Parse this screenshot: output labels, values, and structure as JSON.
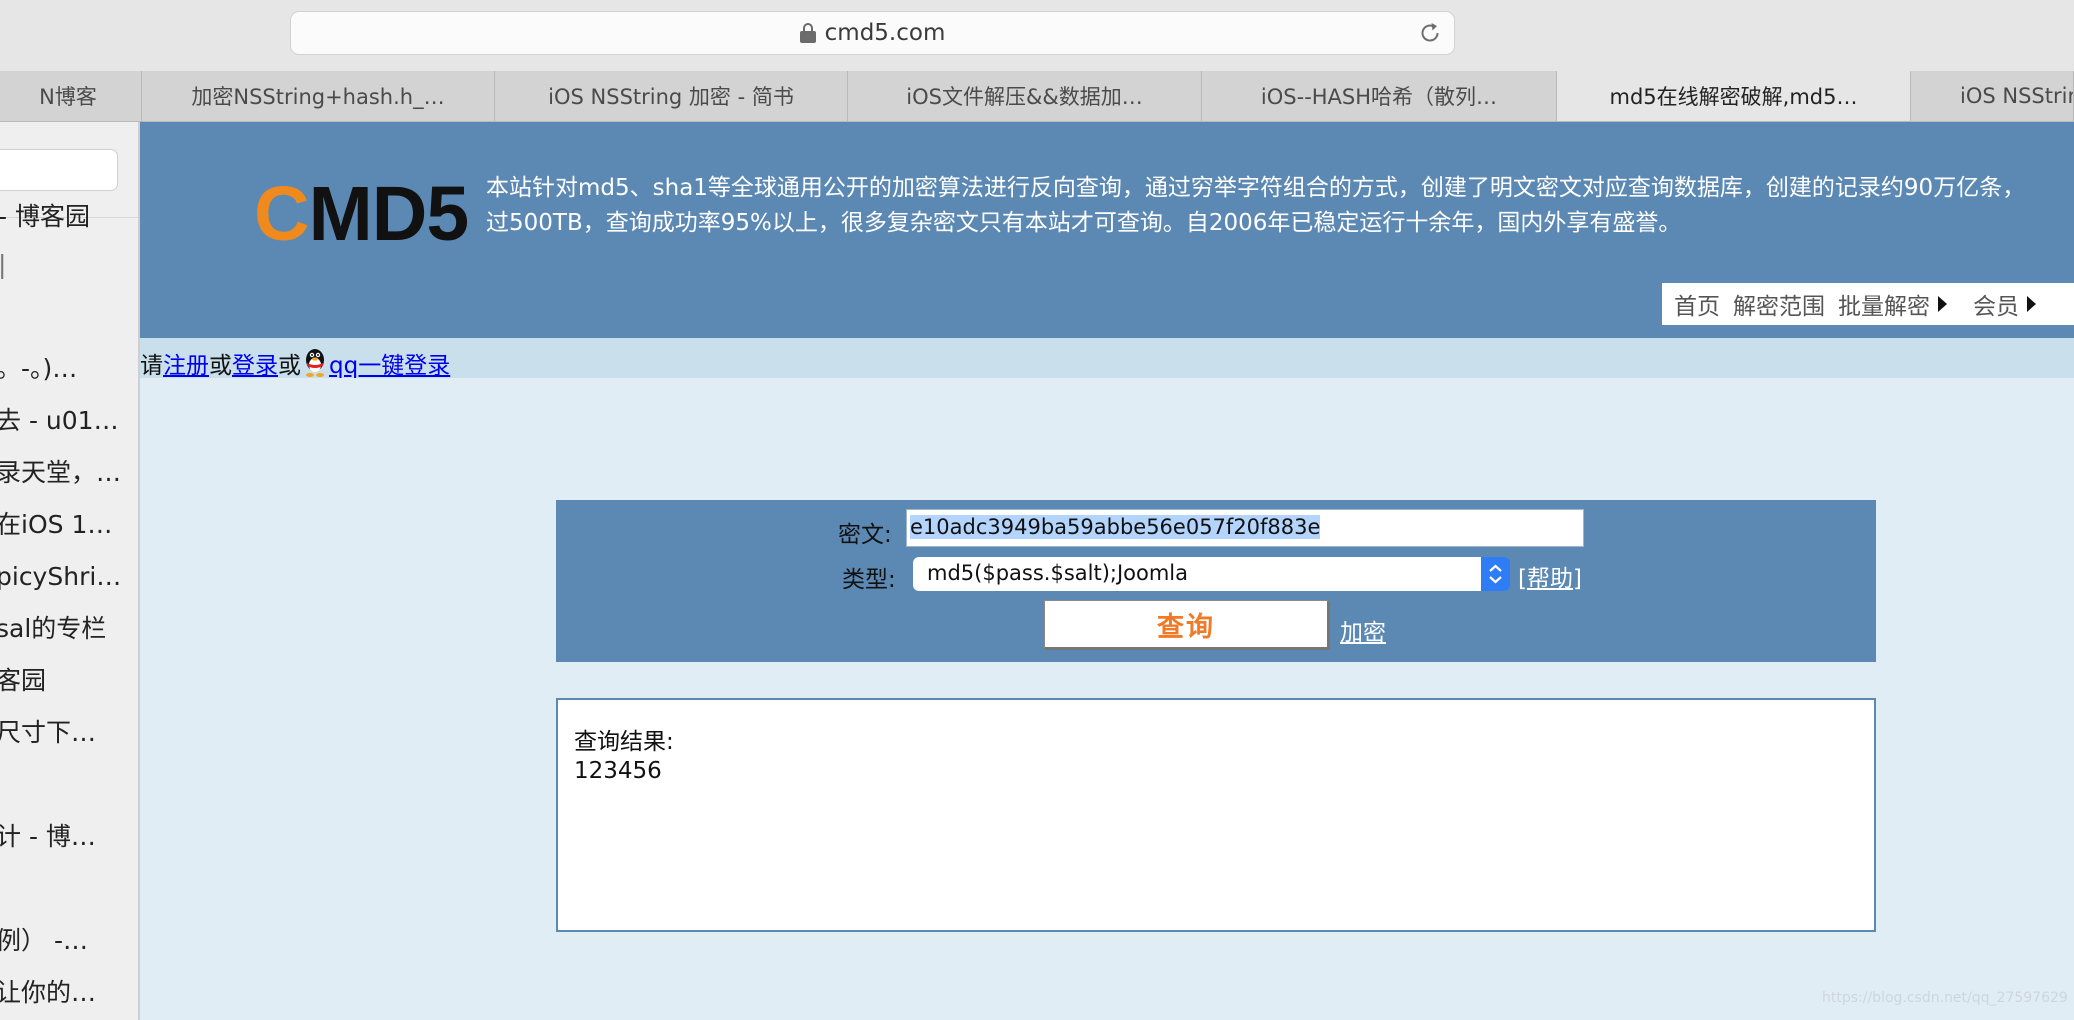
{
  "browser": {
    "url": "cmd5.com",
    "tabs": [
      {
        "label": "N博客"
      },
      {
        "label": "加密NSString+hash.h_…"
      },
      {
        "label": "iOS NSString 加密 - 简书"
      },
      {
        "label": "iOS文件解压&&数据加…"
      },
      {
        "label": "iOS--HASH哈希（散列…"
      },
      {
        "label": "md5在线解密破解,md5…",
        "active": true
      },
      {
        "label": "iOS NSStrin"
      }
    ]
  },
  "sidebar": {
    "items": [
      {
        "label": "- 博客园"
      },
      {
        "label": "|"
      },
      {
        "label": "。-。)…"
      },
      {
        "label": "去 - u01…"
      },
      {
        "label": "录天堂，…"
      },
      {
        "label": "在iOS 1…"
      },
      {
        "label": "picyShri…"
      },
      {
        "label": "sal的专栏"
      },
      {
        "label": "客园"
      },
      {
        "label": "尺寸下…"
      },
      {
        "label": "计 - 博…"
      },
      {
        "label": "例） -…"
      },
      {
        "label": "让你的…"
      }
    ]
  },
  "site": {
    "logo_c": "C",
    "logo_rest": "MD5",
    "intro_line1": "本站针对md5、sha1等全球通用公开的加密算法进行反向查询，通过穷举字符组合的方式，创建了明文密文对应查询数据库，创建的记录约90万亿条，",
    "intro_line2": "过500TB，查询成功率95%以上，很多复杂密文只有本站才可查询。自2006年已稳定运行十余年，国内外享有盛誉。",
    "nav": {
      "home": "首页",
      "scope": "解密范围",
      "batch": "批量解密",
      "member": "会员"
    },
    "login": {
      "prefix": "请",
      "register": "注册",
      "or1": "或",
      "login": "登录",
      "or2": "或",
      "qq_login": "qq一键登录"
    }
  },
  "form": {
    "cipher_label": "密文:",
    "cipher_value": "e10adc3949ba59abbe56e057f20f883e",
    "type_label": "类型:",
    "type_value": "md5($pass.$salt);Joomla",
    "help_open": "[",
    "help_text": "帮助",
    "help_close": "]",
    "query_button": "查询",
    "encrypt_link": "加密"
  },
  "result": {
    "label": "查询结果:",
    "value": "123456"
  },
  "watermark": "https://blog.csdn.net/qq_27597629"
}
